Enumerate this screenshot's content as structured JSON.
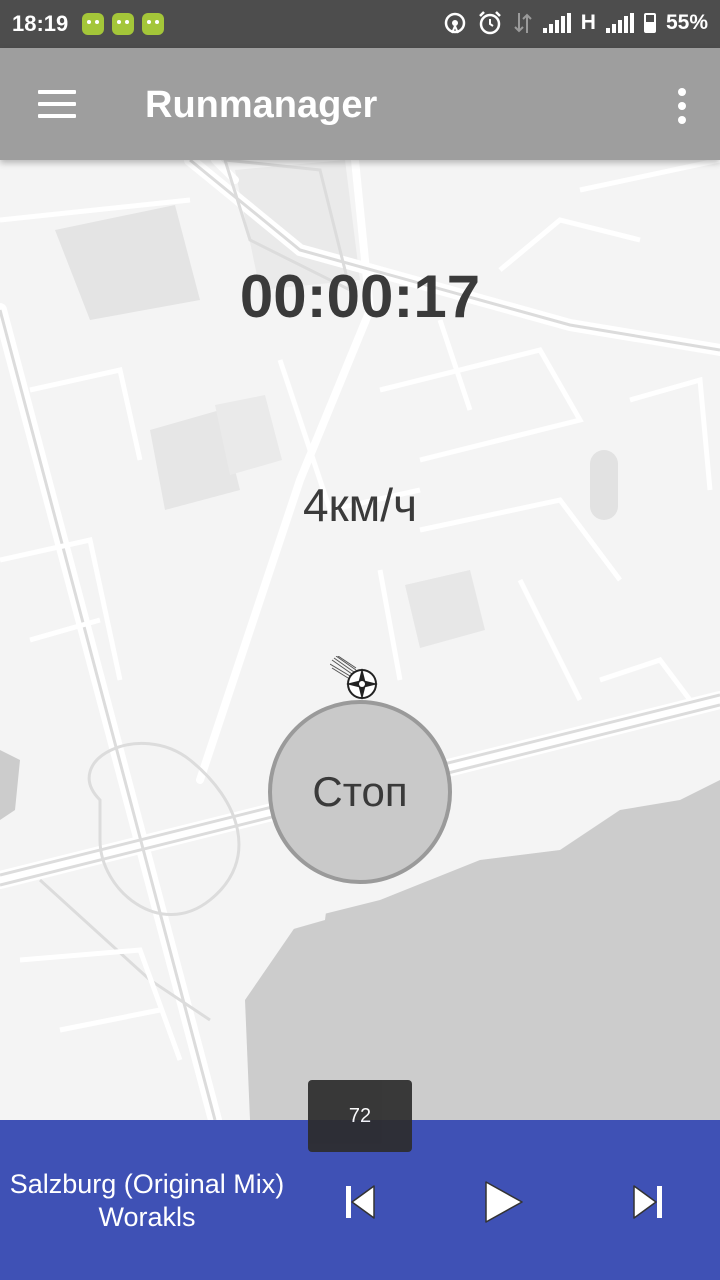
{
  "status_bar": {
    "time": "18:19",
    "network_type": "H",
    "battery_percent": "55%",
    "icons": [
      "android-icon",
      "android-icon",
      "android-icon",
      "hotspot-icon",
      "alarm-icon",
      "data-transfer-icon",
      "signal-icon",
      "signal-icon",
      "battery-icon"
    ]
  },
  "app_bar": {
    "title": "Runmanager",
    "menu_icon": "hamburger-menu-icon",
    "overflow_icon": "more-vert-icon"
  },
  "workout": {
    "elapsed_time": "00:00:17",
    "speed": "4км/ч",
    "stop_label": "Стоп"
  },
  "volume": {
    "level": "72"
  },
  "player": {
    "track_title": "Salzburg (Original Mix)",
    "artist": "Worakls",
    "controls": [
      "skip-previous-icon",
      "play-icon",
      "skip-next-icon"
    ],
    "background_color": "#3f51b5"
  }
}
